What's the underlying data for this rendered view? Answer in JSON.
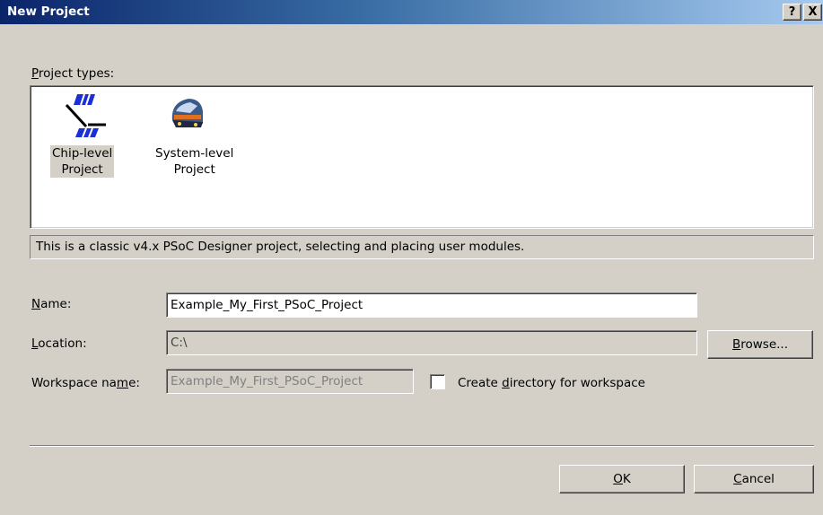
{
  "window": {
    "title": "New Project",
    "help_button": "?",
    "close_button": "X"
  },
  "project_types": {
    "label_prefix": "",
    "label_ul": "P",
    "label_rest": "roject types:",
    "items": [
      {
        "line1": "Chip-level",
        "line2": "Project",
        "icon": "chip-level-icon",
        "selected": true
      },
      {
        "line1": "System-level",
        "line2": "Project",
        "icon": "system-level-icon",
        "selected": false
      }
    ]
  },
  "description": "This is a classic v4.x PSoC Designer project, selecting and placing user modules.",
  "name": {
    "label_ul": "N",
    "label_rest": "ame:",
    "value": "Example_My_First_PSoC_Project"
  },
  "location": {
    "label_ul": "L",
    "label_rest": "ocation:",
    "value": "C:\\",
    "browse_ul": "B",
    "browse_rest": "rowse..."
  },
  "workspace": {
    "label_pre": "Workspace na",
    "label_ul": "m",
    "label_post": "e:",
    "value": "Example_My_First_PSoC_Project",
    "checkbox_pre": "Create ",
    "checkbox_ul": "d",
    "checkbox_post": "irectory for workspace",
    "checked": false
  },
  "buttons": {
    "ok_ul": "O",
    "ok_rest": "K",
    "cancel_ul": "C",
    "cancel_rest": "ancel"
  }
}
